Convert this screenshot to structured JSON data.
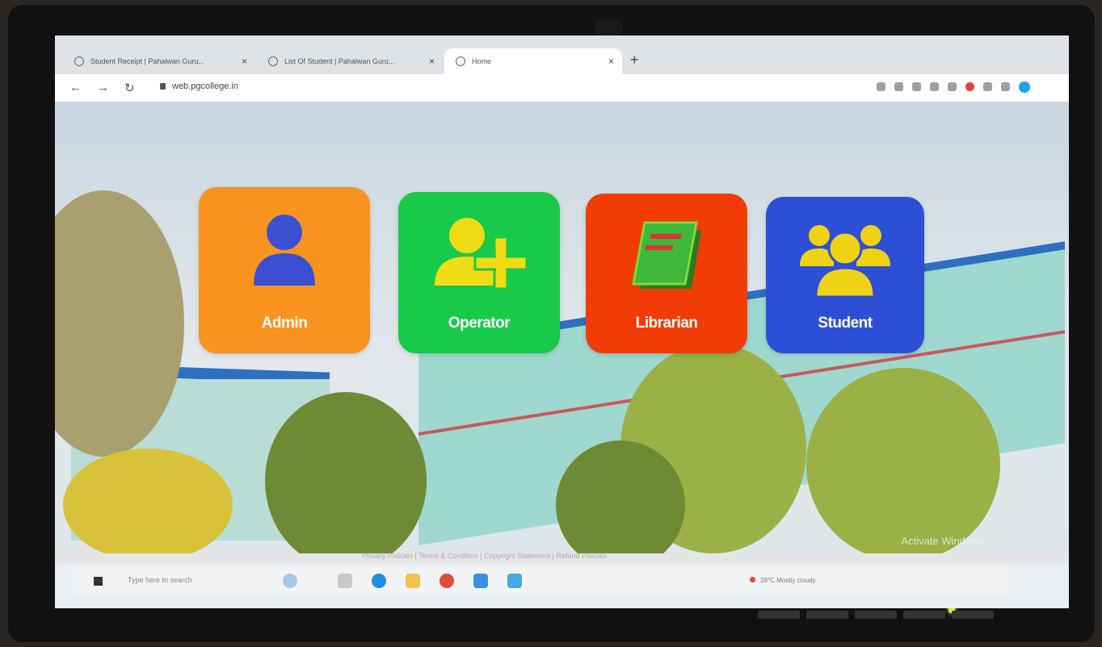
{
  "browser": {
    "tabs": [
      {
        "label": "Student Receipt | Pahalwan Guru...",
        "active": false
      },
      {
        "label": "List Of Student | Pahalwan Guru...",
        "active": false
      },
      {
        "label": "Home",
        "active": true
      }
    ],
    "url": "web.pgcollege.in"
  },
  "roles": [
    {
      "label": "Admin",
      "color": "#f7931e",
      "icon": "user-icon"
    },
    {
      "label": "Operator",
      "color": "#18c94a",
      "icon": "add-user-icon"
    },
    {
      "label": "Librarian",
      "color": "#f23c06",
      "icon": "book-icon"
    },
    {
      "label": "Student",
      "color": "#2d4fd6",
      "icon": "group-icon"
    }
  ],
  "watermark": "Activate Windows",
  "footer": "Privacy Policies | Terms & Condition | Copyright Statement | Refund Policies",
  "taskbar": {
    "search_placeholder": "Type here to search",
    "weather": "28°C  Mostly cloudy"
  }
}
